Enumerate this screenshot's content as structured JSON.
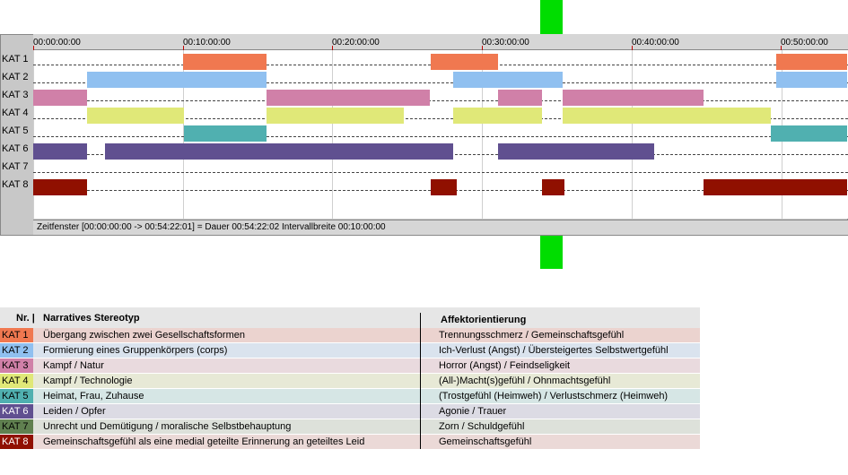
{
  "ruler": {
    "ticks": [
      "00:00:00:00",
      "00:10:00:00",
      "00:20:00:00",
      "00:30:00:00",
      "00:40:00:00",
      "00:50:00:00"
    ]
  },
  "categories": [
    "KAT 1",
    "KAT 2",
    "KAT 3",
    "KAT 4",
    "KAT 5",
    "KAT 6",
    "KAT 7",
    "KAT 8"
  ],
  "colors": {
    "kat1": "#f07850",
    "kat2": "#90c0f0",
    "kat3": "#d080a8",
    "kat4": "#e0e878",
    "kat5": "#50b0b0",
    "kat6": "#605090",
    "kat7": "#608050",
    "kat8": "#901000"
  },
  "segments_minutes": {
    "KAT 1": [
      [
        10.0,
        15.6
      ],
      [
        26.6,
        31.1
      ],
      [
        49.7,
        54.4
      ]
    ],
    "KAT 2": [
      [
        3.6,
        15.6
      ],
      [
        28.1,
        35.4
      ],
      [
        49.7,
        54.4
      ]
    ],
    "KAT 3": [
      [
        0,
        3.6
      ],
      [
        15.6,
        26.5
      ],
      [
        31.1,
        34.0
      ],
      [
        35.4,
        44.8
      ]
    ],
    "KAT 4": [
      [
        3.6,
        10.1
      ],
      [
        15.6,
        24.8
      ],
      [
        28.1,
        34.0
      ],
      [
        35.4,
        49.3
      ]
    ],
    "KAT 5": [
      [
        10.1,
        15.6
      ],
      [
        49.3,
        54.4
      ]
    ],
    "KAT 6": [
      [
        0,
        3.6
      ],
      [
        4.8,
        28.1
      ],
      [
        31.1,
        41.5
      ]
    ],
    "KAT 7": [],
    "KAT 8": [
      [
        0,
        3.6
      ],
      [
        26.6,
        28.3
      ],
      [
        34.0,
        35.5
      ],
      [
        44.8,
        54.4
      ]
    ]
  },
  "status": {
    "text": "Zeitfenster [00:00:00:00 -> 00:54:22:01] = Dauer 00:54:22:02    Intervallbreite 00:10:00:00"
  },
  "legend": {
    "header_nr": "Nr. |",
    "header_stereotyp": "Narratives Stereotyp",
    "header_affekt": "Affektorientierung",
    "rows": [
      {
        "nr": "KAT 1",
        "stereotyp": "Übergang zwischen zwei Gesellschaftsformen",
        "affekt": "Trennungsschmerz / Gemeinschaftsgefühl",
        "color": "#f07850",
        "bg": "#ebd3cf"
      },
      {
        "nr": "KAT 2",
        "stereotyp": "Formierung eines Gruppenkörpers (corps)",
        "affekt": "Ich-Verlust (Angst) / Übersteigertes Selbstwertgefühl",
        "color": "#90c0f0",
        "bg": "#dae3ee"
      },
      {
        "nr": "KAT 3",
        "stereotyp": "Kampf / Natur",
        "affekt": "Horror (Angst) / Feindseligkeit",
        "color": "#d080a8",
        "bg": "#e9dade"
      },
      {
        "nr": "KAT 4",
        "stereotyp": "Kampf / Technologie",
        "affekt": "(All-)Macht(s)gefühl / Ohnmachtsgefühl",
        "color": "#e0e878",
        "bg": "#e7e9d6"
      },
      {
        "nr": "KAT 5",
        "stereotyp": "Heimat, Frau, Zuhause",
        "affekt": "(Trostgefühl (Heimweh) / Verlustschmerz (Heimweh)",
        "color": "#50b0b0",
        "bg": "#d6e6e5"
      },
      {
        "nr": "KAT 6",
        "stereotyp": "Leiden / Opfer",
        "affekt": "Agonie / Trauer",
        "color": "#605090",
        "bg": "#dcdbe4"
      },
      {
        "nr": "KAT 7",
        "stereotyp": "Unrecht und Demütigung / moralische Selbstbehauptung",
        "affekt": "Zorn / Schuldgefühl",
        "color": "#608050",
        "bg": "#dde1da"
      },
      {
        "nr": "KAT 8",
        "stereotyp": "Gemeinschaftsgefühl als eine medial geteilte Erinnerung an geteiltes Leid",
        "affekt": "Gemeinschaftsgefühl",
        "color": "#901000",
        "bg": "#ebd9d7"
      }
    ]
  }
}
